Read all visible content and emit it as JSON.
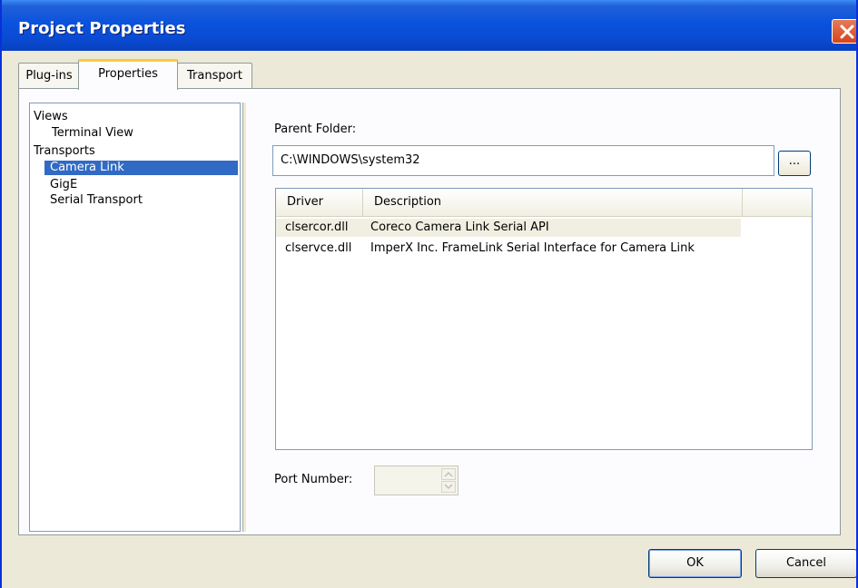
{
  "window": {
    "title": "Project Properties"
  },
  "tabs": [
    {
      "label": "Plug-ins"
    },
    {
      "label": "Properties",
      "active": true
    },
    {
      "label": "Transport"
    }
  ],
  "tree": {
    "items": [
      {
        "label": "Views"
      },
      {
        "label": "Terminal View"
      },
      {
        "label": "Transports"
      },
      {
        "label": "Camera Link",
        "selected": true
      },
      {
        "label": "GigE"
      },
      {
        "label": "Serial Transport"
      }
    ]
  },
  "parent_folder": {
    "label": "Parent Folder:",
    "value": "C:\\WINDOWS\\system32",
    "browse_label": "..."
  },
  "drivers": {
    "columns": [
      "Driver",
      "Description"
    ],
    "rows": [
      {
        "driver": "clsercor.dll",
        "description": "Coreco Camera Link Serial API"
      },
      {
        "driver": "clservce.dll",
        "description": "ImperX Inc. FrameLink Serial Interface for Camera Link"
      }
    ]
  },
  "port_number": {
    "label": "Port Number:",
    "value": ""
  },
  "buttons": {
    "ok": "OK",
    "cancel": "Cancel"
  },
  "colors": {
    "title_bar": "#0a52dd",
    "selection": "#316ac5",
    "active_tab_accent": "#ffc83c",
    "close_button": "#d5451d"
  }
}
